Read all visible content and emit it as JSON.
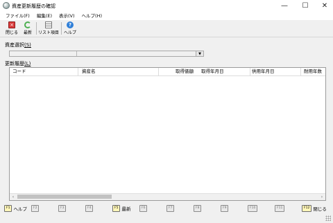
{
  "window": {
    "title": "資産更新履歴の確認",
    "minimize_glyph": "—",
    "maximize_glyph": "☐",
    "close_glyph": "✕"
  },
  "menu": [
    "ファイル(F)",
    "編集(E)",
    "表示(V)",
    "ヘルプ(H)"
  ],
  "toolbar": {
    "close_label": "閉じる",
    "refresh_label": "最新",
    "list_items_label": "リスト項目",
    "help_label": "ヘルプ",
    "icons": [
      "close-icon",
      "refresh-icon",
      "list-icon",
      "help-icon"
    ],
    "colors": {
      "close": "#d83a3a",
      "refresh": "#4caf50",
      "help": "#2f7fd8"
    }
  },
  "asset_select": {
    "label": "資産選択",
    "mnemonic": "(S)",
    "value": "",
    "dropdown_glyph": "▼"
  },
  "history": {
    "label": "更新履歴",
    "mnemonic": "(L)",
    "columns": [
      "コード",
      "資産名",
      "取得価額",
      "取得年月日",
      "供用年月日",
      "耐用年数"
    ],
    "rows": [],
    "scroll_left": "‹",
    "scroll_right": "›"
  },
  "fkeys": [
    {
      "key": "F1",
      "label": "ヘルプ",
      "enabled": true
    },
    {
      "key": "F2",
      "label": "",
      "enabled": false
    },
    {
      "key": "F3",
      "label": "",
      "enabled": false
    },
    {
      "key": "F4",
      "label": "",
      "enabled": false
    },
    {
      "key": "F5",
      "label": "最新",
      "enabled": true
    },
    {
      "key": "F6",
      "label": "",
      "enabled": false
    },
    {
      "key": "F7",
      "label": "",
      "enabled": false
    },
    {
      "key": "F8",
      "label": "",
      "enabled": false
    },
    {
      "key": "F9",
      "label": "",
      "enabled": false
    },
    {
      "key": "F10",
      "label": "",
      "enabled": false
    },
    {
      "key": "F11",
      "label": "",
      "enabled": false
    },
    {
      "key": "F12",
      "label": "閉じる",
      "enabled": true
    }
  ]
}
